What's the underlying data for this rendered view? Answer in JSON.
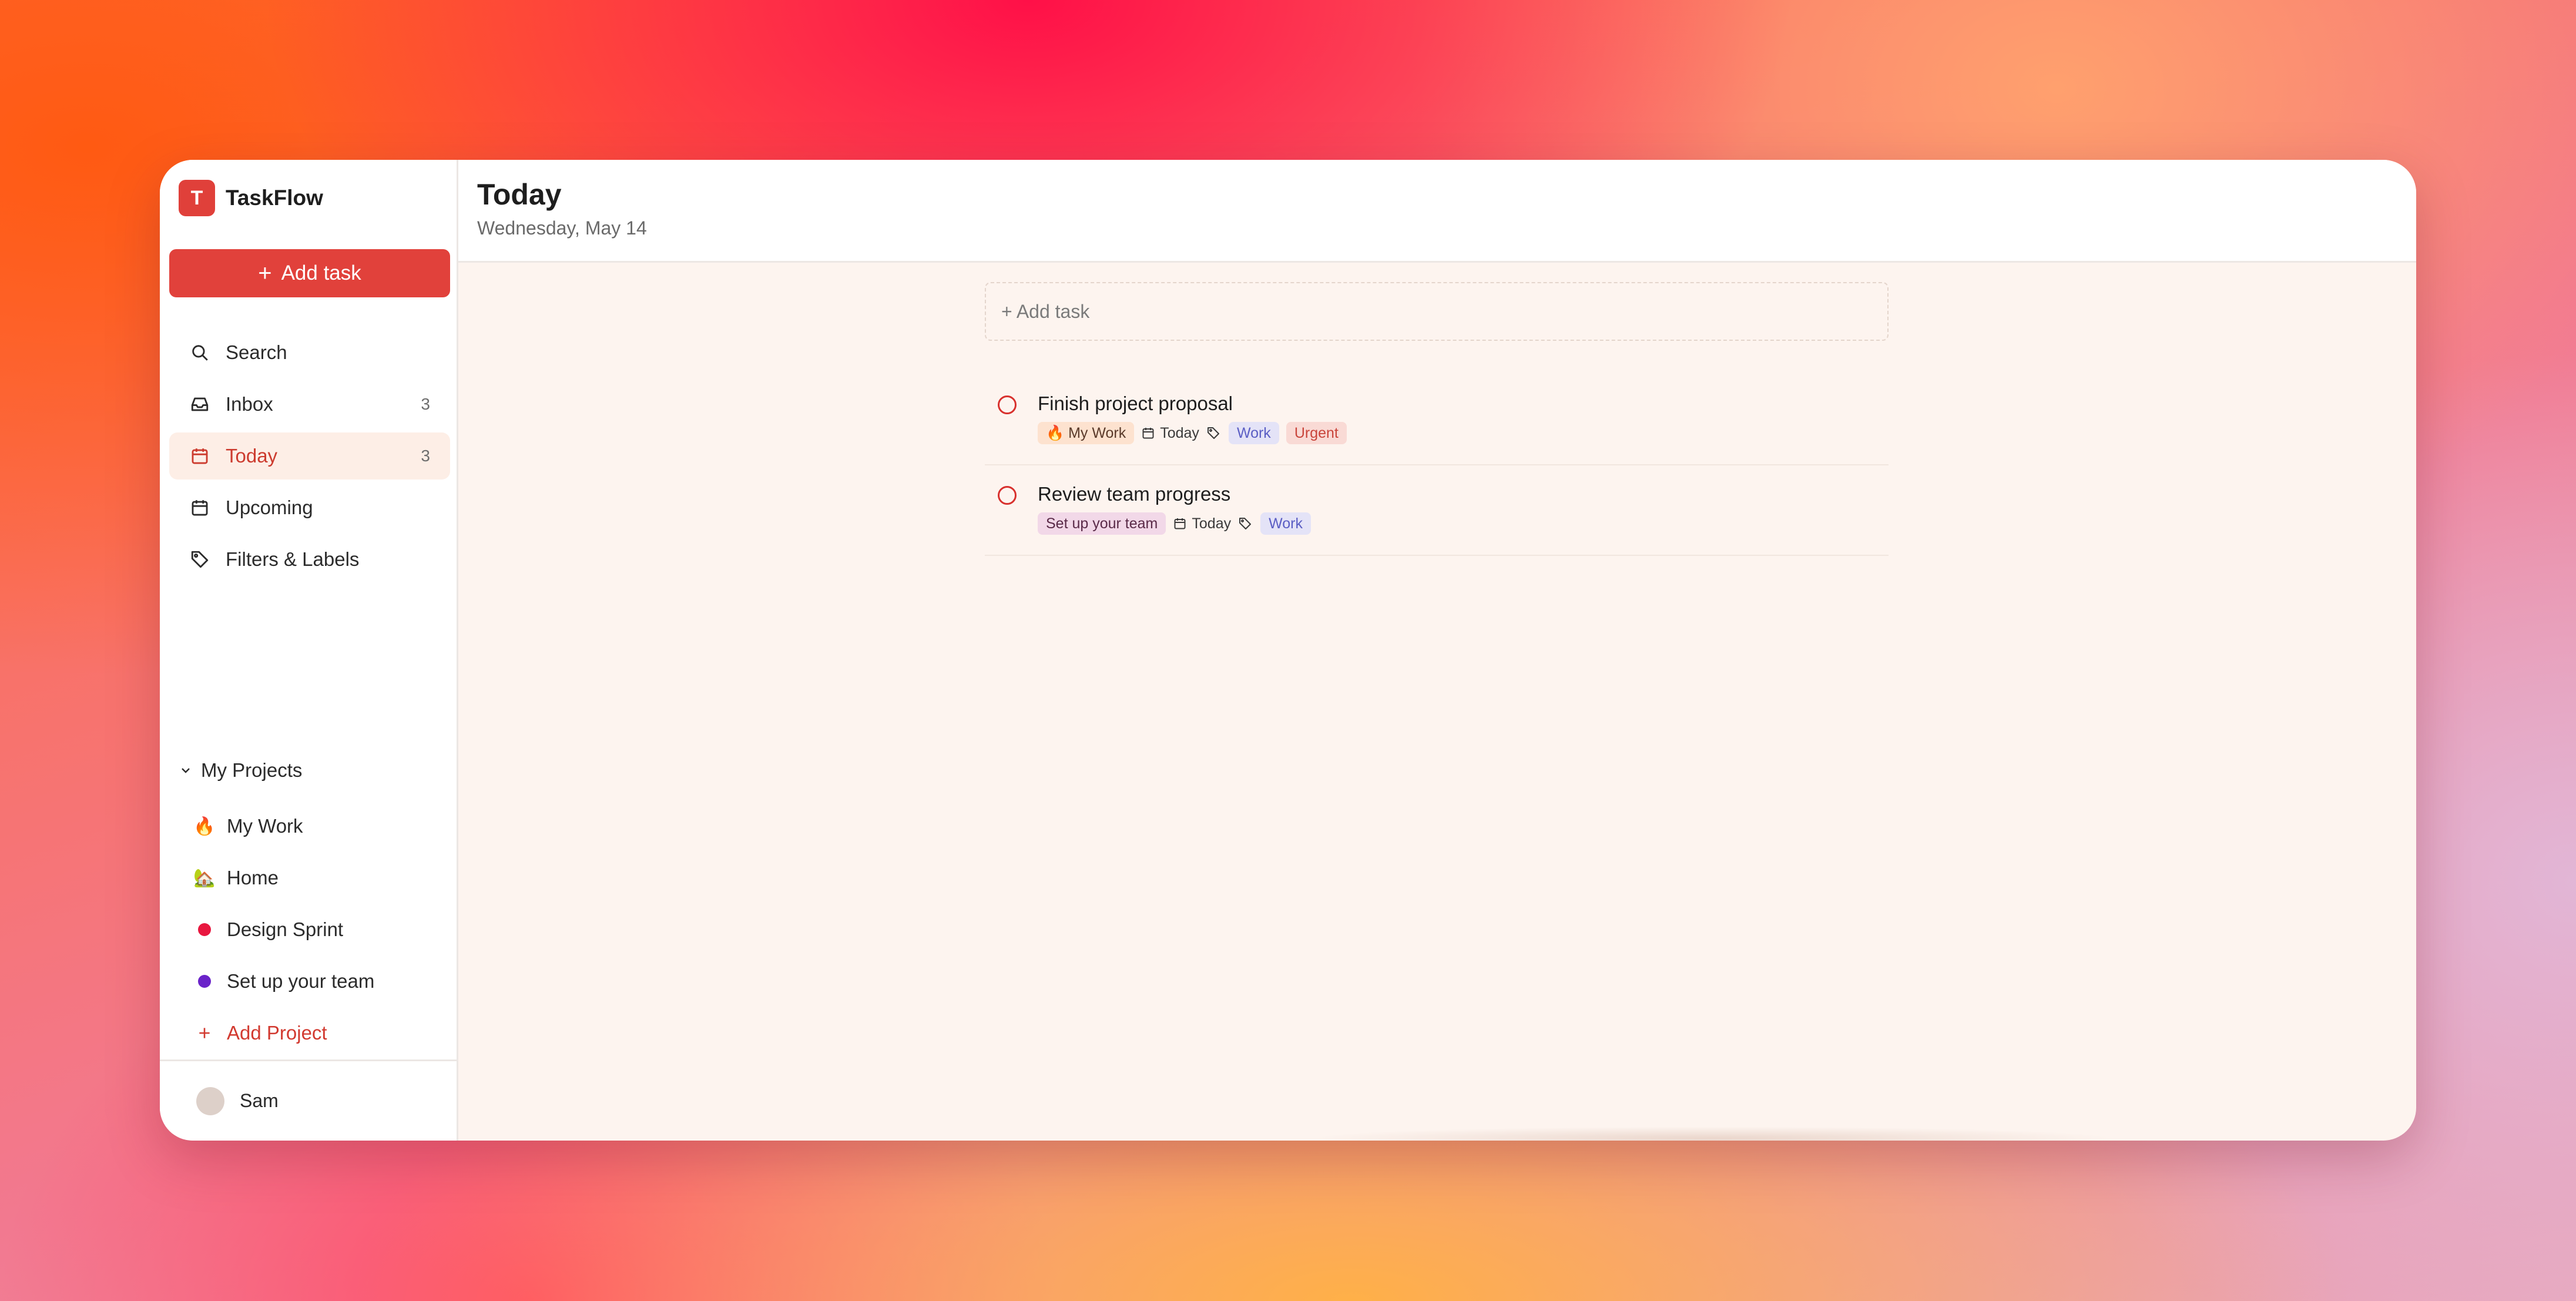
{
  "app": {
    "name": "TaskFlow",
    "logo_letter": "T",
    "accent": "#e1413b"
  },
  "sidebar": {
    "add_task_label": "Add task",
    "nav": [
      {
        "label": "Search",
        "icon": "search-icon",
        "count": ""
      },
      {
        "label": "Inbox",
        "icon": "inbox-icon",
        "count": "3"
      },
      {
        "label": "Today",
        "icon": "calendar-icon",
        "count": "3",
        "active": true
      },
      {
        "label": "Upcoming",
        "icon": "calendar-icon",
        "count": ""
      },
      {
        "label": "Filters & Labels",
        "icon": "tag-icon",
        "count": ""
      }
    ],
    "projects_heading": "My Projects",
    "projects": [
      {
        "label": "My Work",
        "marker": "🔥"
      },
      {
        "label": "Home",
        "marker": "🏡"
      },
      {
        "label": "Design Sprint",
        "marker": "dot",
        "color": "#e8173f"
      },
      {
        "label": "Set up your team",
        "marker": "dot",
        "color": "#6a23c9"
      }
    ],
    "add_project_label": "Add Project",
    "user": {
      "name": "Sam"
    }
  },
  "main": {
    "title": "Today",
    "subtitle": "Wednesday, May 14",
    "quick_add_placeholder": "+ Add task",
    "tasks": [
      {
        "title": "Finish project proposal",
        "project": "🔥 My Work",
        "due": "Today",
        "labels": [
          "Work",
          "Urgent"
        ]
      },
      {
        "title": "Review team progress",
        "project": "Set up your team",
        "due": "Today",
        "labels": [
          "Work"
        ]
      }
    ]
  }
}
